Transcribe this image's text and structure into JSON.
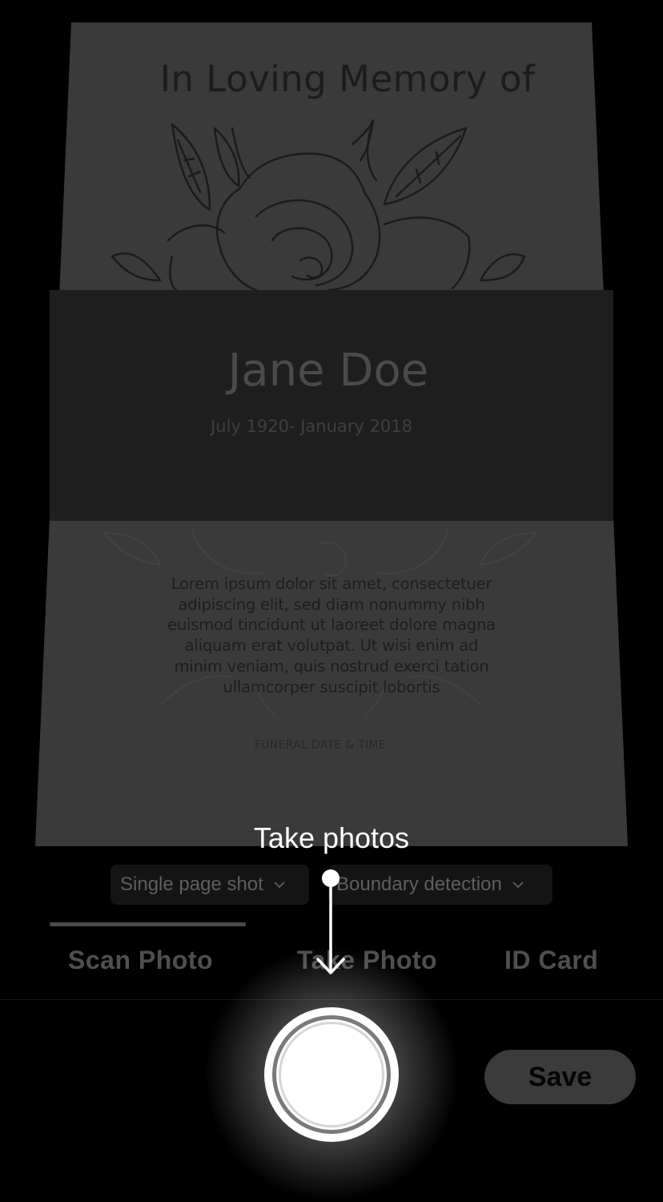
{
  "document": {
    "title": "In Loving Memory of",
    "name": "Jane Doe",
    "dates": "July 1920- January 2018",
    "body_lines": [
      "Lorem ipsum dolor sit amet, consectetuer",
      "adipiscing elit, sed diam nonummy nibh",
      "euismod tincidunt ut laoreet dolore magna",
      "aliquam erat volutpat. Ut wisi enim ad",
      "minim veniam, quis nostrud exerci tation",
      "ullamcorper suscipit lobortis"
    ],
    "funeral_label": "FUNERAL DATE & TIME"
  },
  "tooltip": {
    "label": "Take photos"
  },
  "options": {
    "page_mode": "Single page shot",
    "detection": "Boundary detection"
  },
  "tabs": [
    {
      "label": "Scan Photo",
      "active": true
    },
    {
      "label": "Take Photo",
      "active": false
    },
    {
      "label": "ID Card",
      "active": false
    }
  ],
  "actions": {
    "save_label": "Save"
  },
  "icons": {
    "dropdown": "chevron-down-icon",
    "shutter": "shutter-icon",
    "arrow": "arrow-down-icon"
  },
  "colors": {
    "background": "#000000",
    "document": "#3a3a3a",
    "band": "#1e1e1e",
    "shutter": "#ffffff"
  }
}
